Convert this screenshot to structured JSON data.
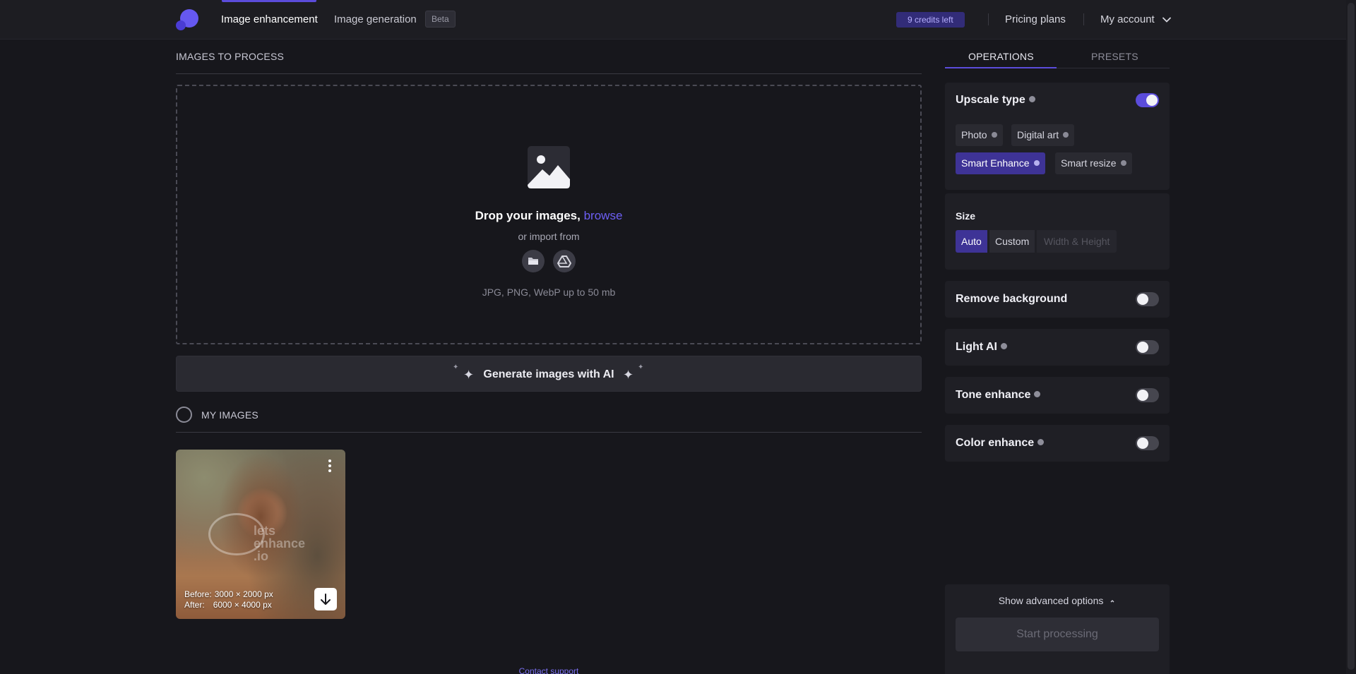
{
  "header": {
    "nav_enhancement": "Image enhancement",
    "nav_generation": "Image generation",
    "beta_badge": "Beta",
    "credits": "9 credits left",
    "pricing": "Pricing plans",
    "account": "My account"
  },
  "upload": {
    "section_title": "IMAGES TO PROCESS",
    "drop_text": "Drop your images,",
    "browse": "browse",
    "import_text": "or import from",
    "formats": "JPG, PNG, WebP up to 50 mb",
    "import_sources": [
      "folder-icon",
      "google-drive-icon"
    ]
  },
  "generate": {
    "label": "Generate images with AI"
  },
  "my_images": {
    "title": "MY IMAGES",
    "items": [
      {
        "before_label": "Before:",
        "before_value": "3000 × 2000 px",
        "after_label": "After:",
        "after_value": "6000 × 4000 px"
      }
    ]
  },
  "footer": {
    "contact": "Contact support"
  },
  "sidebar": {
    "tabs": [
      "OPERATIONS",
      "PRESETS"
    ],
    "active_tab": "OPERATIONS",
    "upscale": {
      "title": "Upscale type",
      "enabled": true,
      "options": [
        "Photo",
        "Digital art",
        "Smart Enhance",
        "Smart resize"
      ],
      "selected": "Smart Enhance"
    },
    "size": {
      "title": "Size",
      "options": [
        "Auto",
        "Custom",
        "Width & Height"
      ],
      "selected": "Auto"
    },
    "toggles": [
      {
        "label": "Remove background",
        "enabled": false
      },
      {
        "label": "Light AI",
        "enabled": false
      },
      {
        "label": "Tone enhance",
        "enabled": false
      },
      {
        "label": "Color enhance",
        "enabled": false
      }
    ],
    "advanced": "Show advanced options",
    "start": "Start processing"
  },
  "colors": {
    "accent": "#5b4cdb",
    "background": "#17171c",
    "panel": "#1f1f25",
    "link": "#6d5ff5"
  }
}
